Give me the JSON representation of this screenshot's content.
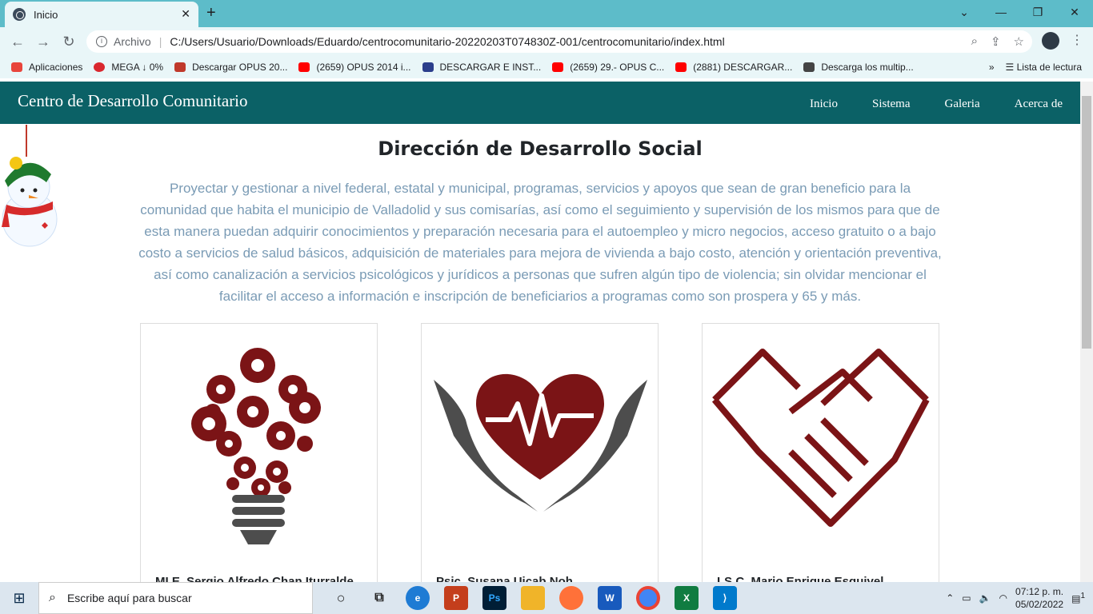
{
  "browser": {
    "tab_title": "Inicio",
    "address_scheme": "Archivo",
    "address_url": "C:/Users/Usuario/Downloads/Eduardo/centrocomunitario-20220203T074830Z-001/centrocomunitario/index.html",
    "bookmarks": [
      {
        "label": "Aplicaciones",
        "color": "#e8453c"
      },
      {
        "label": "MEGA ↓ 0%",
        "color": "#d9272e"
      },
      {
        "label": "Descargar OPUS 20...",
        "color": "#c0392b"
      },
      {
        "label": "(2659) OPUS 2014 i...",
        "color": "#ff0000"
      },
      {
        "label": "DESCARGAR E INST...",
        "color": "#2b3e8c"
      },
      {
        "label": "(2659) 29.- OPUS C...",
        "color": "#ff0000"
      },
      {
        "label": "(2881) DESCARGAR...",
        "color": "#ff0000"
      },
      {
        "label": "Descarga los multip...",
        "color": "#444444"
      }
    ],
    "more_bookmarks": "»",
    "reading_list": "Lista de lectura"
  },
  "site": {
    "brand": "Centro de Desarrollo Comunitario",
    "nav": [
      "Inicio",
      "Sistema",
      "Galeria",
      "Acerca de"
    ],
    "heading": "Dirección de Desarrollo Social",
    "description": "Proyectar y gestionar a nivel federal, estatal y municipal, programas, servicios y apoyos que sean de gran beneficio para la comunidad que habita el municipio de Valladolid y sus comisarías, así como el seguimiento y supervisión de los mismos para que de esta manera puedan adquirir conocimientos y preparación necesaria para el autoempleo y micro negocios, acceso gratuito o a bajo costo a servicios de salud básicos, adquisición de materiales para mejora de vivienda a bajo costo, atención y orientación preventiva, así como canalización a servicios psicológicos y jurídicos a personas que sufren algún tipo de violencia; sin olvidar mencionar el facilitar el acceso a información e inscripción de beneficiarios a programas como son prospera y 65 y más.",
    "cards": [
      {
        "name": "MI.E. Sergio Alfredo Chan Iturralde",
        "icon": "lightbulb-gears-icon"
      },
      {
        "name": "Psic. Susana Uicab Noh",
        "icon": "heart-hands-icon"
      },
      {
        "name": "LS.C. Mario Enrique Esquivel",
        "icon": "handshake-icon"
      }
    ]
  },
  "taskbar": {
    "search_placeholder": "Escribe aquí para buscar",
    "time": "07:12 p. m.",
    "date": "05/02/2022",
    "notifications": "1"
  },
  "colors": {
    "nav_bg": "#0b6166",
    "accent": "#7b1416",
    "desc_text": "#7a9bb5"
  }
}
